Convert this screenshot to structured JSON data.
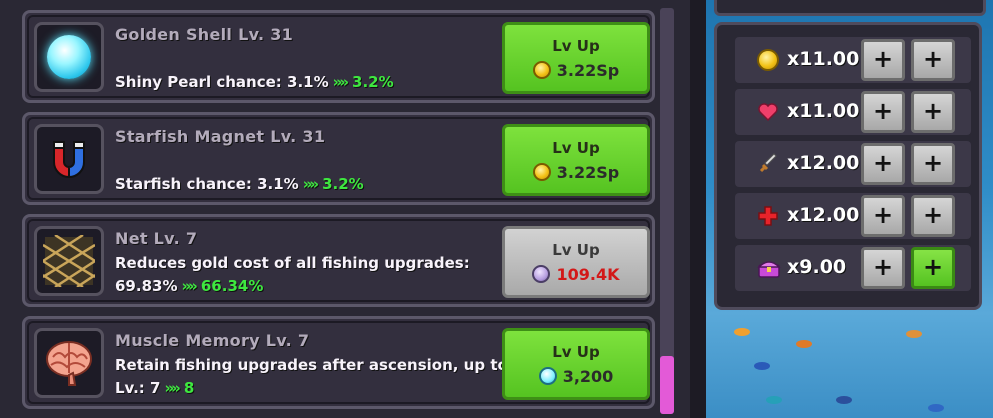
{
  "upgrades": [
    {
      "title": "Golden Shell Lv. 31",
      "desc_line1": "",
      "desc_prefix": "Shiny Pearl chance: 3.1%",
      "new_value": "3.2%",
      "button": {
        "label": "Lv Up",
        "cost": "3.22Sp",
        "currency": "coin",
        "state": "enabled"
      }
    },
    {
      "title": "Starfish Magnet Lv. 31",
      "desc_line1": "",
      "desc_prefix": "Starfish chance: 3.1%",
      "new_value": "3.2%",
      "button": {
        "label": "Lv Up",
        "cost": "3.22Sp",
        "currency": "coin",
        "state": "enabled"
      }
    },
    {
      "title": "Net Lv. 7",
      "desc_line1": "Reduces gold cost of all fishing upgrades:",
      "desc_prefix": "69.83%",
      "new_value": "66.34%",
      "button": {
        "label": "Lv Up",
        "cost": "109.4K",
        "currency": "purple-orb",
        "state": "disabled"
      }
    },
    {
      "title": "Muscle Memory Lv. 7",
      "desc_line1": "Retain fishing upgrades after ascension, up to",
      "desc_prefix": "Lv.: 7",
      "new_value": "8",
      "button": {
        "label": "Lv Up",
        "cost": "3,200",
        "currency": "cyan-orb",
        "state": "enabled"
      }
    }
  ],
  "icons": [
    "pearl-icon",
    "magnet-icon",
    "net-icon",
    "brain-icon"
  ],
  "multipliers": [
    {
      "icon": "gold-coin-icon",
      "value": "x11.00",
      "plus1": "+",
      "plus2": "+",
      "plus2_active": false
    },
    {
      "icon": "heart-icon",
      "value": "x11.00",
      "plus1": "+",
      "plus2": "+",
      "plus2_active": false
    },
    {
      "icon": "sword-icon",
      "value": "x12.00",
      "plus1": "+",
      "plus2": "+",
      "plus2_active": false
    },
    {
      "icon": "red-cross-icon",
      "value": "x12.00",
      "plus1": "+",
      "plus2": "+",
      "plus2_active": false
    },
    {
      "icon": "treasure-chest-icon",
      "value": "x9.00",
      "plus1": "+",
      "plus2": "+",
      "plus2_active": true
    }
  ],
  "colors": {
    "accent_green": "#3ee83f",
    "cost_red": "#d31818",
    "scroll_thumb": "#e35ad7"
  }
}
